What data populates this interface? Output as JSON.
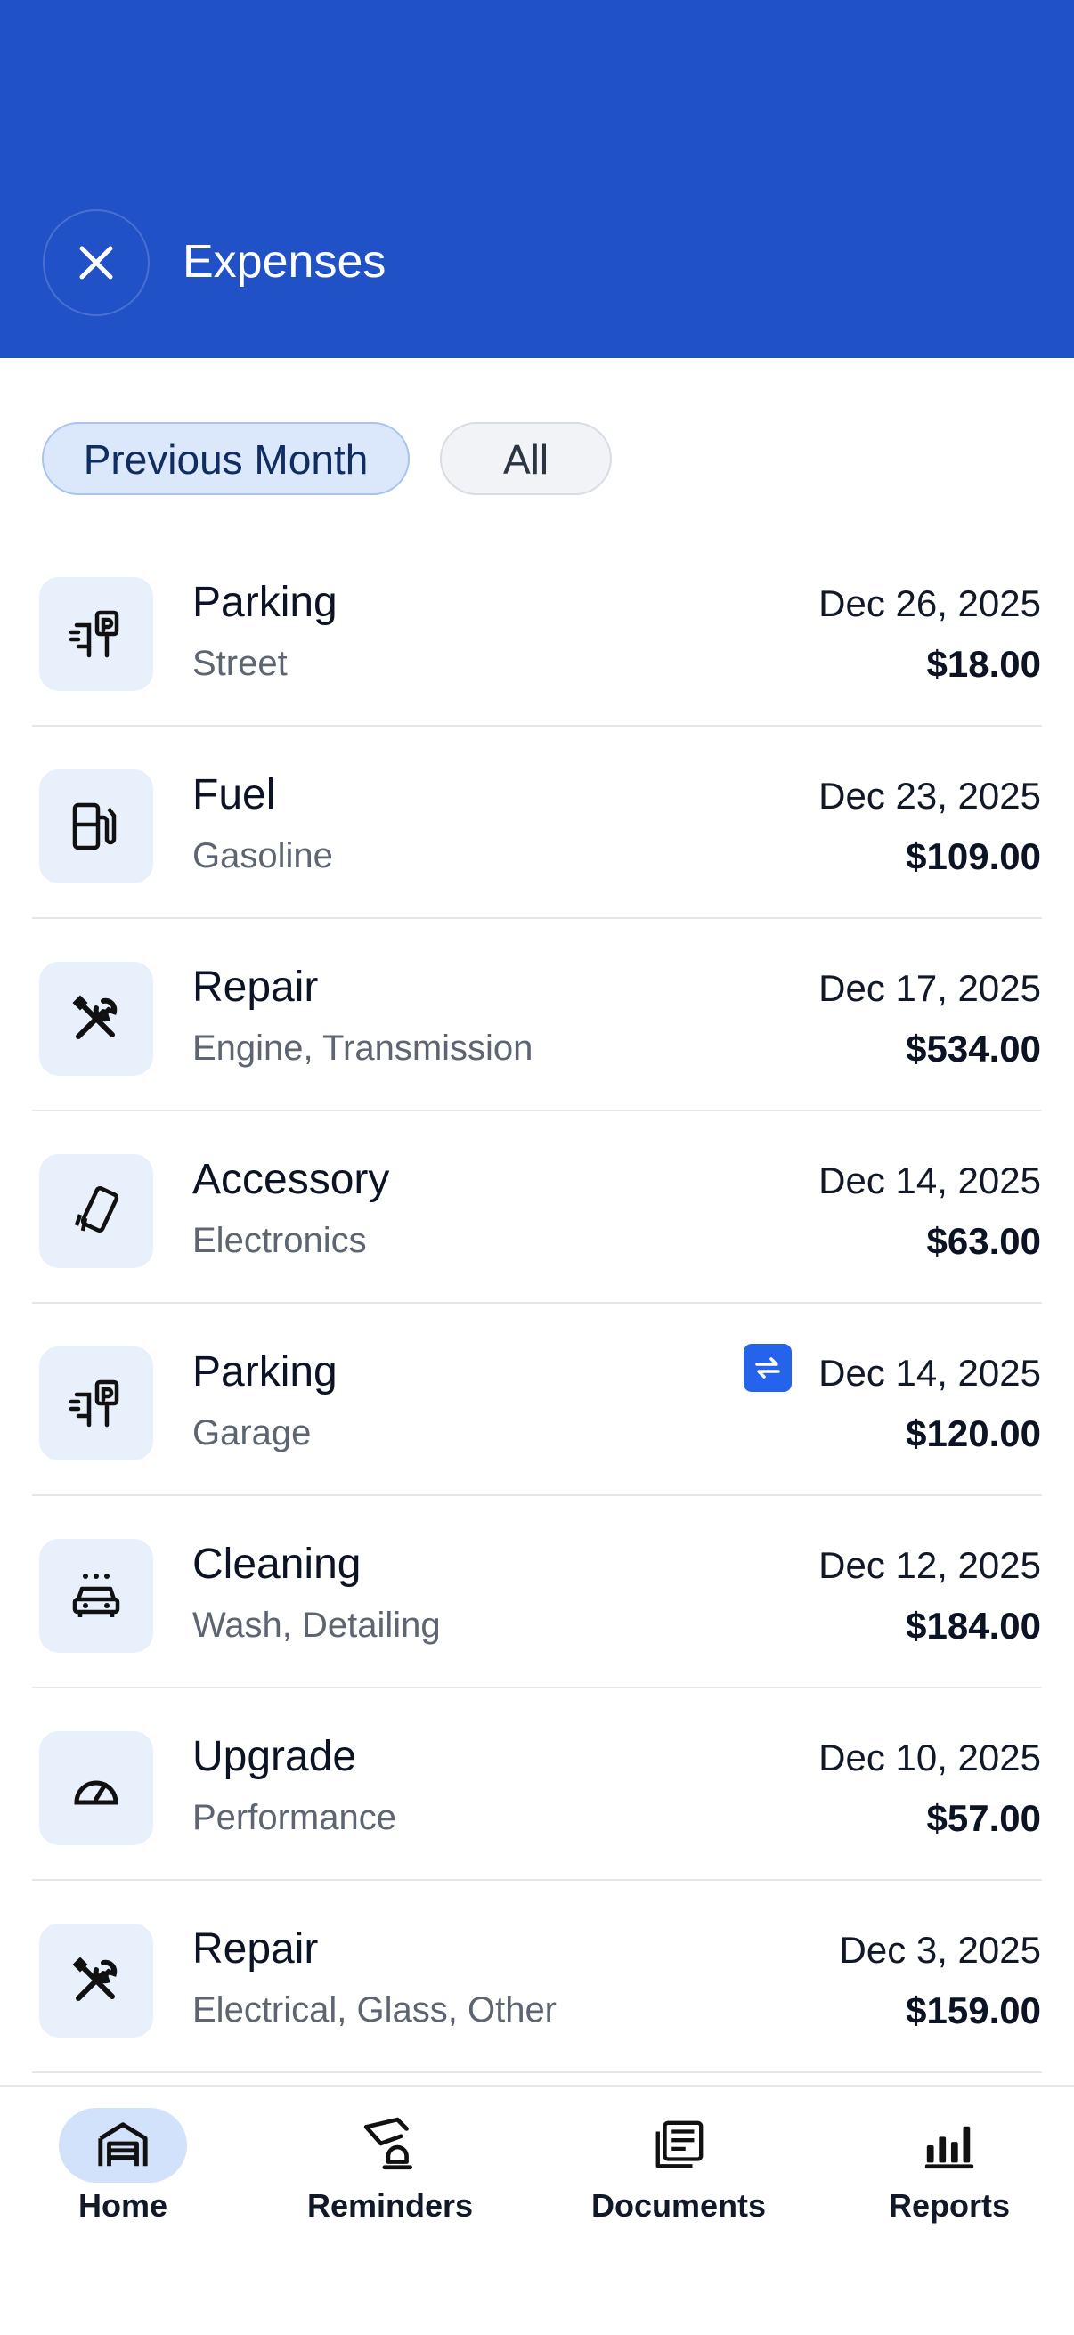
{
  "header": {
    "title": "Expenses"
  },
  "filters": {
    "previous_month": "Previous Month",
    "all": "All"
  },
  "expenses": [
    {
      "category": "Parking",
      "detail": "Street",
      "date": "Dec 26, 2025",
      "amount": "$18.00",
      "icon": "parking-icon"
    },
    {
      "category": "Fuel",
      "detail": "Gasoline",
      "date": "Dec 23, 2025",
      "amount": "$109.00",
      "icon": "fuel-pump-icon"
    },
    {
      "category": "Repair",
      "detail": "Engine, Transmission",
      "date": "Dec 17, 2025",
      "amount": "$534.00",
      "icon": "tools-icon"
    },
    {
      "category": "Accessory",
      "detail": "Electronics",
      "date": "Dec 14, 2025",
      "amount": "$63.00",
      "icon": "phone-vibrate-icon"
    },
    {
      "category": "Parking",
      "detail": "Garage",
      "date": "Dec 14, 2025",
      "amount": "$120.00",
      "icon": "parking-icon",
      "recurring": true
    },
    {
      "category": "Cleaning",
      "detail": "Wash, Detailing",
      "date": "Dec 12, 2025",
      "amount": "$184.00",
      "icon": "car-wash-icon"
    },
    {
      "category": "Upgrade",
      "detail": "Performance",
      "date": "Dec 10, 2025",
      "amount": "$57.00",
      "icon": "speedometer-icon"
    },
    {
      "category": "Repair",
      "detail": "Electrical, Glass, Other",
      "date": "Dec 3, 2025",
      "amount": "$159.00",
      "icon": "tools-icon"
    }
  ],
  "nav": {
    "home": "Home",
    "reminders": "Reminders",
    "documents": "Documents",
    "reports": "Reports"
  },
  "colors": {
    "header": "#2051c6",
    "accent": "#2563eb",
    "icon_bg": "#e8f0fc"
  }
}
